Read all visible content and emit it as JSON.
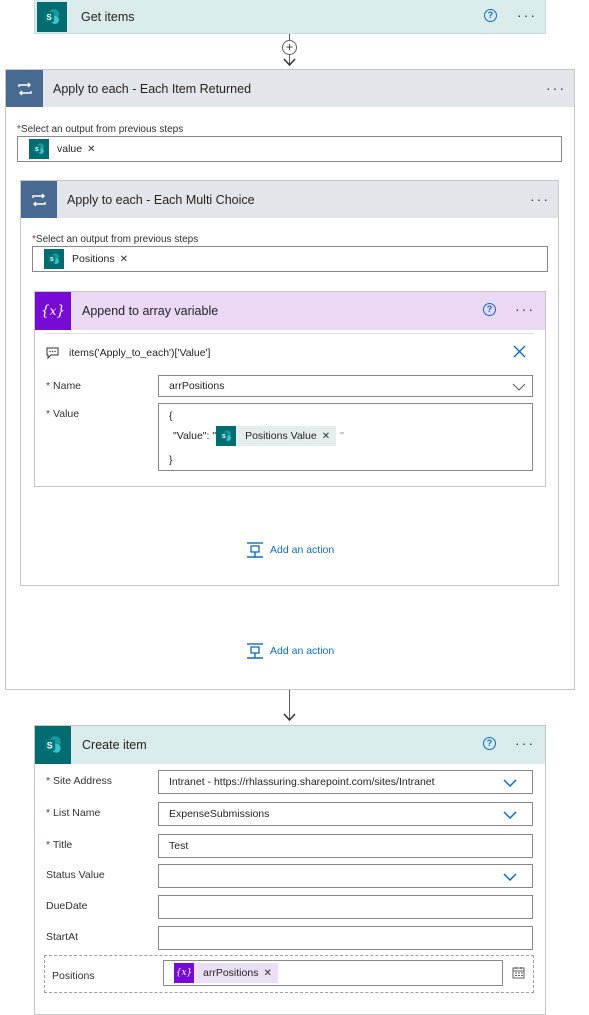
{
  "get_items": {
    "title": "Get items"
  },
  "outer_loop": {
    "title": "Apply to each - Each Item Returned",
    "select_label": "Select an output from previous steps",
    "token": "value"
  },
  "inner_loop": {
    "title": "Apply to each - Each Multi Choice",
    "select_label": "Select an output from previous steps",
    "token": "Positions"
  },
  "append": {
    "title": "Append to array variable",
    "comment": "items('Apply_to_each')['Value']",
    "name_label": "Name",
    "name_value": "arrPositions",
    "value_label": "Value",
    "value_line1": "{",
    "value_line2_prefix": "\"Value\": \"",
    "value_token": "Positions Value",
    "value_line2_suffix": "\"",
    "value_line3": "}"
  },
  "add_action_label": "Add an action",
  "create_item": {
    "title": "Create item",
    "fields": {
      "site_address": {
        "label": "Site Address",
        "value": "Intranet - https://rhlassuring.sharepoint.com/sites/Intranet"
      },
      "list_name": {
        "label": "List Name",
        "value": "ExpenseSubmissions"
      },
      "title": {
        "label": "Title",
        "value": "Test"
      },
      "status_value": {
        "label": "Status Value",
        "value": ""
      },
      "due_date": {
        "label": "DueDate",
        "value": ""
      },
      "start_at": {
        "label": "StartAt",
        "value": ""
      },
      "positions": {
        "label": "Positions",
        "token": "arrPositions"
      }
    }
  },
  "icons": {
    "sharepoint": "sharepoint-icon",
    "loop": "loop-icon",
    "variable": "variable-icon",
    "more": "more-icon",
    "help": "help-icon",
    "add": "plus-circle-icon",
    "close": "close-icon",
    "comment": "comment-icon",
    "chevron": "chevron-down-icon",
    "add_action": "add-action-icon",
    "switch_mode": "switch-mode-icon"
  },
  "colors": {
    "sharepoint": "#036c70",
    "sharepoint_header_bg": "#d9ebeb",
    "loop": "#486991",
    "loop_header_bg": "#e2e5ea",
    "variable": "#770bd6",
    "variable_header_bg": "#ead8f5",
    "link": "#0f6cbd",
    "required": "#a4262c"
  }
}
